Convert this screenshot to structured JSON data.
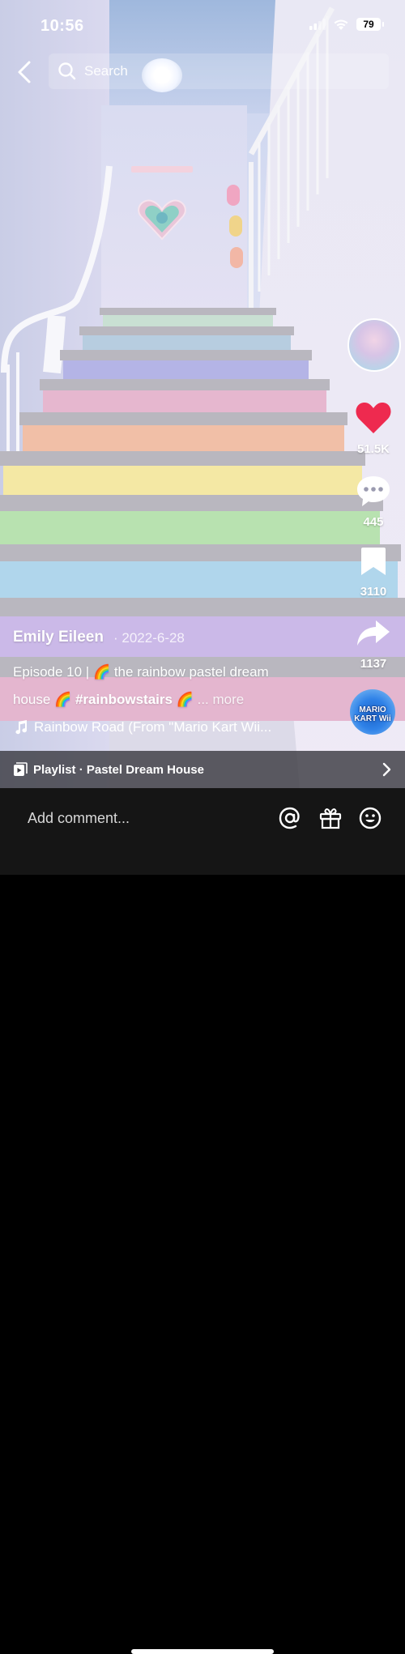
{
  "status_bar": {
    "time": "10:56",
    "battery": "79"
  },
  "header": {
    "search_placeholder": "Search"
  },
  "actions": {
    "likes": "51.5K",
    "comments": "445",
    "saves": "3110",
    "shares": "1137"
  },
  "post": {
    "author": "Emily Eileen",
    "date": "· 2022-6-28",
    "caption_line1_a": "Episode 10 | ",
    "caption_line1_b": " the rainbow pastel dream",
    "caption_line2_a": "house ",
    "hashtag": "#rainbowstairs",
    "more": "... more",
    "emoji_rainbow": "🌈",
    "music": "Rainbow Road (From \"Mario Kart Wii...",
    "disc_label": "MARIO KART Wii"
  },
  "playlist": {
    "label": "Playlist · Pastel Dream House"
  },
  "comment": {
    "placeholder": "Add comment..."
  },
  "colors": {
    "like_red": "#ee2a4f",
    "step_colors": [
      "#c9e0d3",
      "#b7cde0",
      "#b4b4e6",
      "#e6b7cf",
      "#f1bfa7",
      "#f4e8a4",
      "#b8e2b0",
      "#b0d6ec",
      "#cbb9e8",
      "#e4b6cf"
    ]
  }
}
